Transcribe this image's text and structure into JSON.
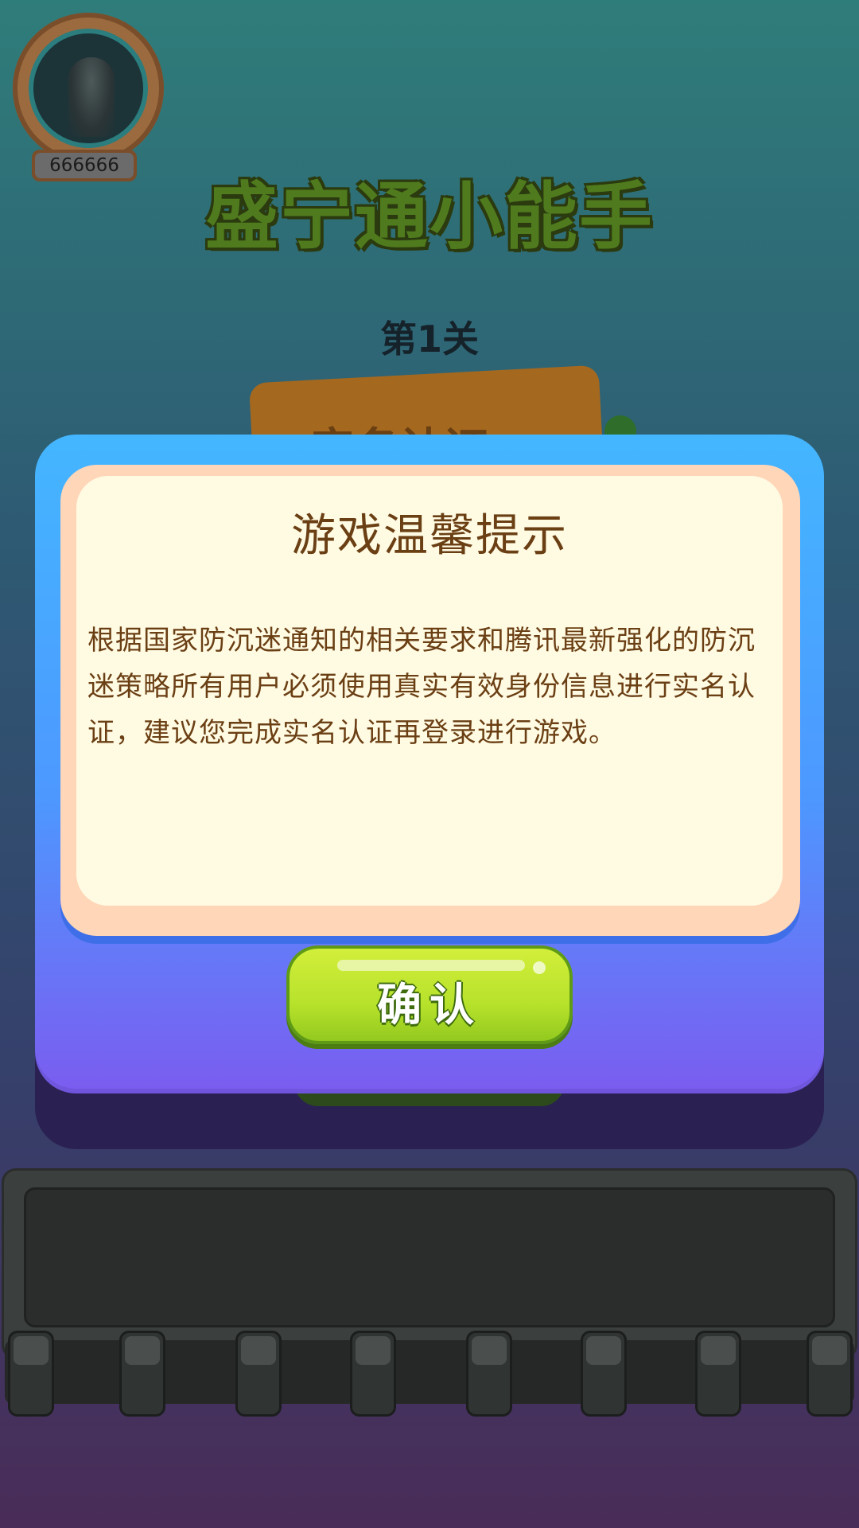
{
  "player": {
    "avatar_icon": "hooded-figure-avatar-icon",
    "score": "666666"
  },
  "game": {
    "title": "盛宁通小能手",
    "level": "第1关"
  },
  "background": {
    "hidden_button_text": "实名认证"
  },
  "dialog": {
    "title": "游戏温馨提示",
    "body": "根据国家防沉迷通知的相关要求和腾讯最新强化的防沉迷策略所有用户必须使用真实有效身份信息进行实名认证，建议您完成实名认证再登录进行游戏。",
    "confirm_label": "确认"
  },
  "tray": {
    "slot_count": 8
  },
  "colors": {
    "dialog_top": "#44b6ff",
    "dialog_bottom": "#7b5cf0",
    "panel_bg": "#fffbe3",
    "text_brown": "#6b3f14",
    "confirm_green": "#b7e22b"
  }
}
